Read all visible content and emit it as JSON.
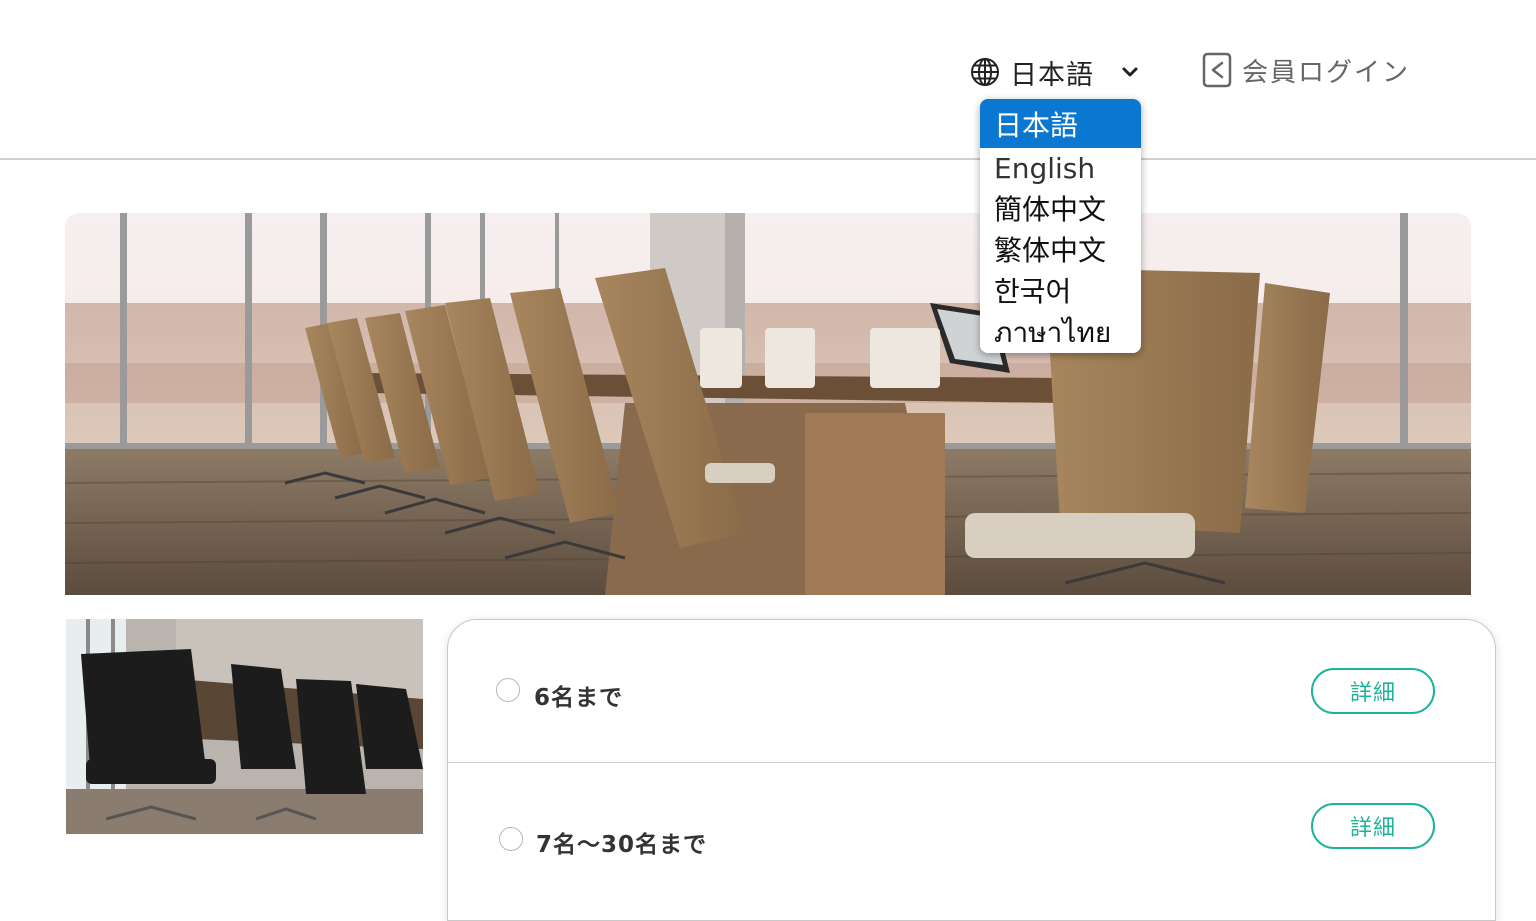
{
  "header": {
    "language": {
      "current": "日本語",
      "icon": "globe-icon",
      "chevron": "chevron-down-icon"
    },
    "login": {
      "label": "会員ログイン",
      "icon": "login-icon"
    }
  },
  "language_dropdown": {
    "options": [
      "日本語",
      "English",
      "簡体中文",
      "繁体中文",
      "한국어",
      "ภาษาไทย"
    ],
    "selected_index": 0
  },
  "plans": [
    {
      "label": "6名まで",
      "detail_label": "詳細"
    },
    {
      "label": "7名～30名まで",
      "detail_label": "詳細"
    }
  ],
  "colors": {
    "accent": "#1bb39a",
    "dropdown_selected": "#0a78d1"
  }
}
